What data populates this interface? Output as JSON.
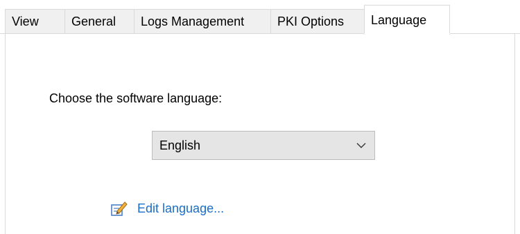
{
  "tabs": [
    {
      "label": "View",
      "active": false
    },
    {
      "label": "General",
      "active": false
    },
    {
      "label": "Logs Management",
      "active": false
    },
    {
      "label": "PKI Options",
      "active": false
    },
    {
      "label": "Language",
      "active": true
    }
  ],
  "language_panel": {
    "prompt": "Choose the software language:",
    "selected_language": "English",
    "dropdown_icon": "chevron-down-icon",
    "edit_link": {
      "label": "Edit language...",
      "icon": "pencil-edit-icon"
    }
  },
  "colors": {
    "link": "#1a6dc8",
    "tab_background": "#f0f0f0",
    "dropdown_background": "#e5e5e5",
    "border": "#d9d9d9"
  }
}
